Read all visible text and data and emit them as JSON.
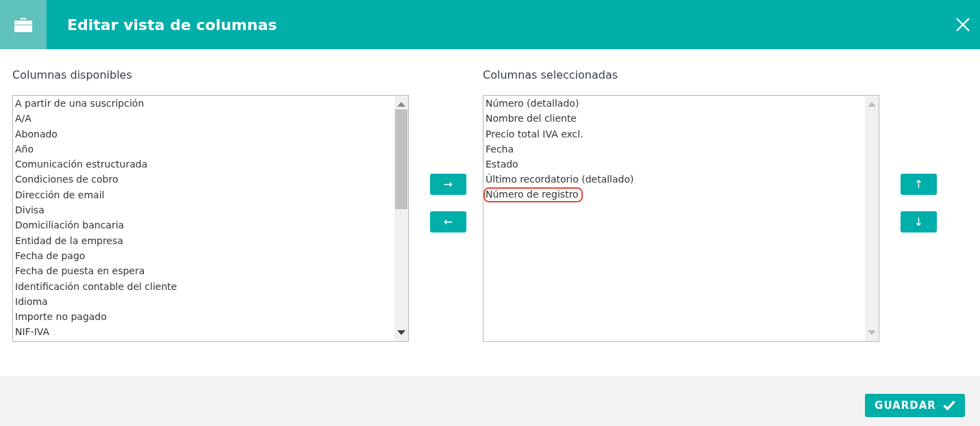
{
  "window": {
    "title": "Editar vista de columnas"
  },
  "available": {
    "label": "Columnas disponibles",
    "items": [
      {
        "text": "A partir de una suscripción",
        "highlighted": false
      },
      {
        "text": "A/A",
        "highlighted": false
      },
      {
        "text": "Abonado",
        "highlighted": false
      },
      {
        "text": "Año",
        "highlighted": false
      },
      {
        "text": "Comunicación estructurada",
        "highlighted": false
      },
      {
        "text": "Condiciones de cobro",
        "highlighted": false
      },
      {
        "text": "Dirección de email",
        "highlighted": false
      },
      {
        "text": "Divisa",
        "highlighted": false
      },
      {
        "text": "Domiciliación bancaria",
        "highlighted": false
      },
      {
        "text": "Entidad de la empresa",
        "highlighted": false
      },
      {
        "text": "Fecha de pago",
        "highlighted": false
      },
      {
        "text": "Fecha de puesta en espera",
        "highlighted": false
      },
      {
        "text": "Identificación contable del cliente",
        "highlighted": false
      },
      {
        "text": "Idioma",
        "highlighted": false
      },
      {
        "text": "Importe no pagado",
        "highlighted": false
      },
      {
        "text": "NIF-IVA",
        "highlighted": false
      }
    ]
  },
  "transfer_buttons": [
    "→",
    "←"
  ],
  "selected": {
    "label": "Columnas seleccionadas",
    "items": [
      {
        "text": "Número (detallado)",
        "highlighted": false
      },
      {
        "text": "Nombre del cliente",
        "highlighted": false
      },
      {
        "text": "Precio total IVA excl.",
        "highlighted": false
      },
      {
        "text": "Fecha",
        "highlighted": false
      },
      {
        "text": "Estado",
        "highlighted": false
      },
      {
        "text": "Último recordatorio (detallado)",
        "highlighted": false
      },
      {
        "text": "Número de registro",
        "highlighted": true
      }
    ]
  },
  "order_buttons": [
    "↑",
    "↓"
  ],
  "footer": {
    "save_button": "GUARDAR"
  }
}
